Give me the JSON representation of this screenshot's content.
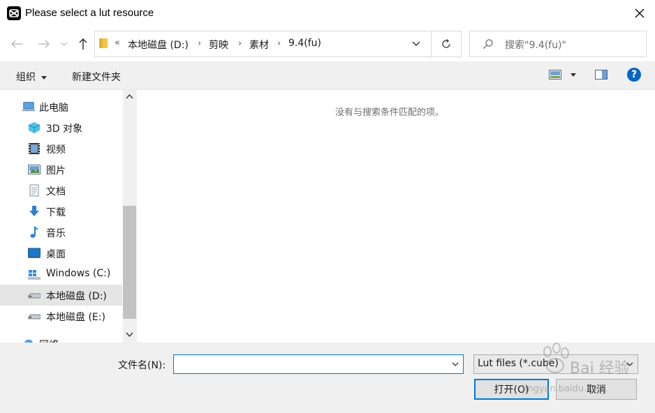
{
  "window": {
    "title": "Please select a lut resource"
  },
  "nav": {
    "breadcrumb_overflow": "«",
    "breadcrumbs": [
      "本地磁盘 (D:)",
      "剪映",
      "素材",
      "9.4(fu)"
    ],
    "search_placeholder": "搜索\"9.4(fu)\""
  },
  "commands": {
    "organize": "组织",
    "new_folder": "新建文件夹",
    "help": "?"
  },
  "tree": [
    {
      "label": "此电脑",
      "icon": "computer-icon",
      "selected": false
    },
    {
      "label": "3D 对象",
      "icon": "3d-objects-icon",
      "selected": false
    },
    {
      "label": "视频",
      "icon": "video-icon",
      "selected": false
    },
    {
      "label": "图片",
      "icon": "pictures-icon",
      "selected": false
    },
    {
      "label": "文档",
      "icon": "documents-icon",
      "selected": false
    },
    {
      "label": "下载",
      "icon": "downloads-icon",
      "selected": false
    },
    {
      "label": "音乐",
      "icon": "music-icon",
      "selected": false
    },
    {
      "label": "桌面",
      "icon": "desktop-icon",
      "selected": false
    },
    {
      "label": "Windows (C:)",
      "icon": "windows-drive-icon",
      "selected": false
    },
    {
      "label": "本地磁盘 (D:)",
      "icon": "drive-icon",
      "selected": true
    },
    {
      "label": "本地磁盘 (E:)",
      "icon": "drive-icon",
      "selected": false
    },
    {
      "label": "网络",
      "icon": "network-icon",
      "selected": false
    }
  ],
  "content": {
    "empty_message": "没有与搜索条件匹配的项。"
  },
  "footer": {
    "filename_label": "文件名(N):",
    "filename_value": "",
    "filetype_value": "Lut files (*.cube)",
    "open_label": "打开(O)",
    "cancel_label": "取消"
  },
  "watermark": {
    "text": "Bai 经验",
    "url": "jingyan.baidu.com"
  },
  "colors": {
    "accent": "#0078d7",
    "selection": "#e5e5e5",
    "panel": "#f0f0f0"
  }
}
